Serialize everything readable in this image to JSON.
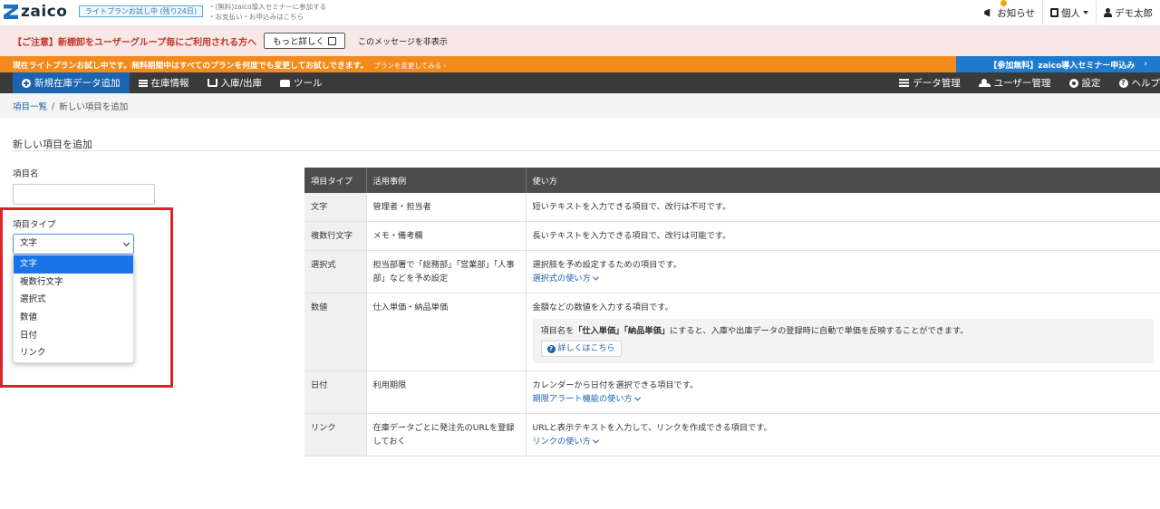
{
  "header": {
    "logo_text": "zaico",
    "trial_badge": "ライトプランお試し中 (残り24日)",
    "seminar_link": "・(無料)zaico導入セミナーに参加する",
    "payment_link": "・お支払い・お申込みはこちら",
    "notifications_label": "お知らせ",
    "workspace_label": "個人",
    "user_label": "デモ太郎"
  },
  "caution": {
    "text": "【ご注意】新棚卸をユーザーグループ毎にご利用される方へ",
    "more_button": "もっと詳しく",
    "dismiss": "このメッセージを非表示"
  },
  "trialbar": {
    "text": "現在ライトプランお試し中です。無料期間中はすべてのプランを何度でも変更してお試しできます。",
    "link": "プランを変更してみる ›",
    "seminar_button": "【参加無料】zaico導入セミナー申込み",
    "seminar_chevron": "›"
  },
  "nav": {
    "add_item": "新規在庫データ追加",
    "inventory": "在庫情報",
    "inout": "入庫/出庫",
    "tools": "ツール",
    "data_manage": "データ管理",
    "user_manage": "ユーザー管理",
    "settings": "設定",
    "help": "ヘルプ"
  },
  "breadcrumb": {
    "parent": "項目一覧",
    "separator": "/",
    "current": "新しい項目を追加"
  },
  "form": {
    "title": "新しい項目を追加",
    "name_label": "項目名",
    "name_value": "",
    "type_label": "項目タイプ",
    "type_selected": "文字",
    "type_options": [
      "文字",
      "複数行文字",
      "選択式",
      "数値",
      "日付",
      "リンク"
    ]
  },
  "table": {
    "headers": [
      "項目タイプ",
      "活用事例",
      "使い方"
    ],
    "rows": [
      {
        "type": "文字",
        "example": "管理者・担当者",
        "usage": "短いテキストを入力できる項目で、改行は不可です。"
      },
      {
        "type": "複数行文字",
        "example": "メモ・備考欄",
        "usage": "長いテキストを入力できる項目で、改行は可能です。"
      },
      {
        "type": "選択式",
        "example": "担当部署で「総務部」「営業部」「人事部」などを予め設定",
        "usage": "選択肢を予め設定するための項目です。",
        "link": "選択式の使い方"
      },
      {
        "type": "数値",
        "example": "仕入単価・納品単価",
        "usage": "金額などの数値を入力する項目です。",
        "hint_prefix": "項目名を",
        "hint_bold": "「仕入単価」「納品単価」",
        "hint_suffix": "にすると、入庫や出庫データの登録時に自動で単価を反映することができます。",
        "hint_button": "詳しくはこちら"
      },
      {
        "type": "日付",
        "example": "利用期限",
        "usage": "カレンダーから日付を選択できる項目です。",
        "link": "期限アラート機能の使い方"
      },
      {
        "type": "リンク",
        "example": "在庫データごとに発注先のURLを登録しておく",
        "usage": "URLと表示テキストを入力して、リンクを作成できる項目です。",
        "link": "リンクの使い方"
      }
    ]
  }
}
